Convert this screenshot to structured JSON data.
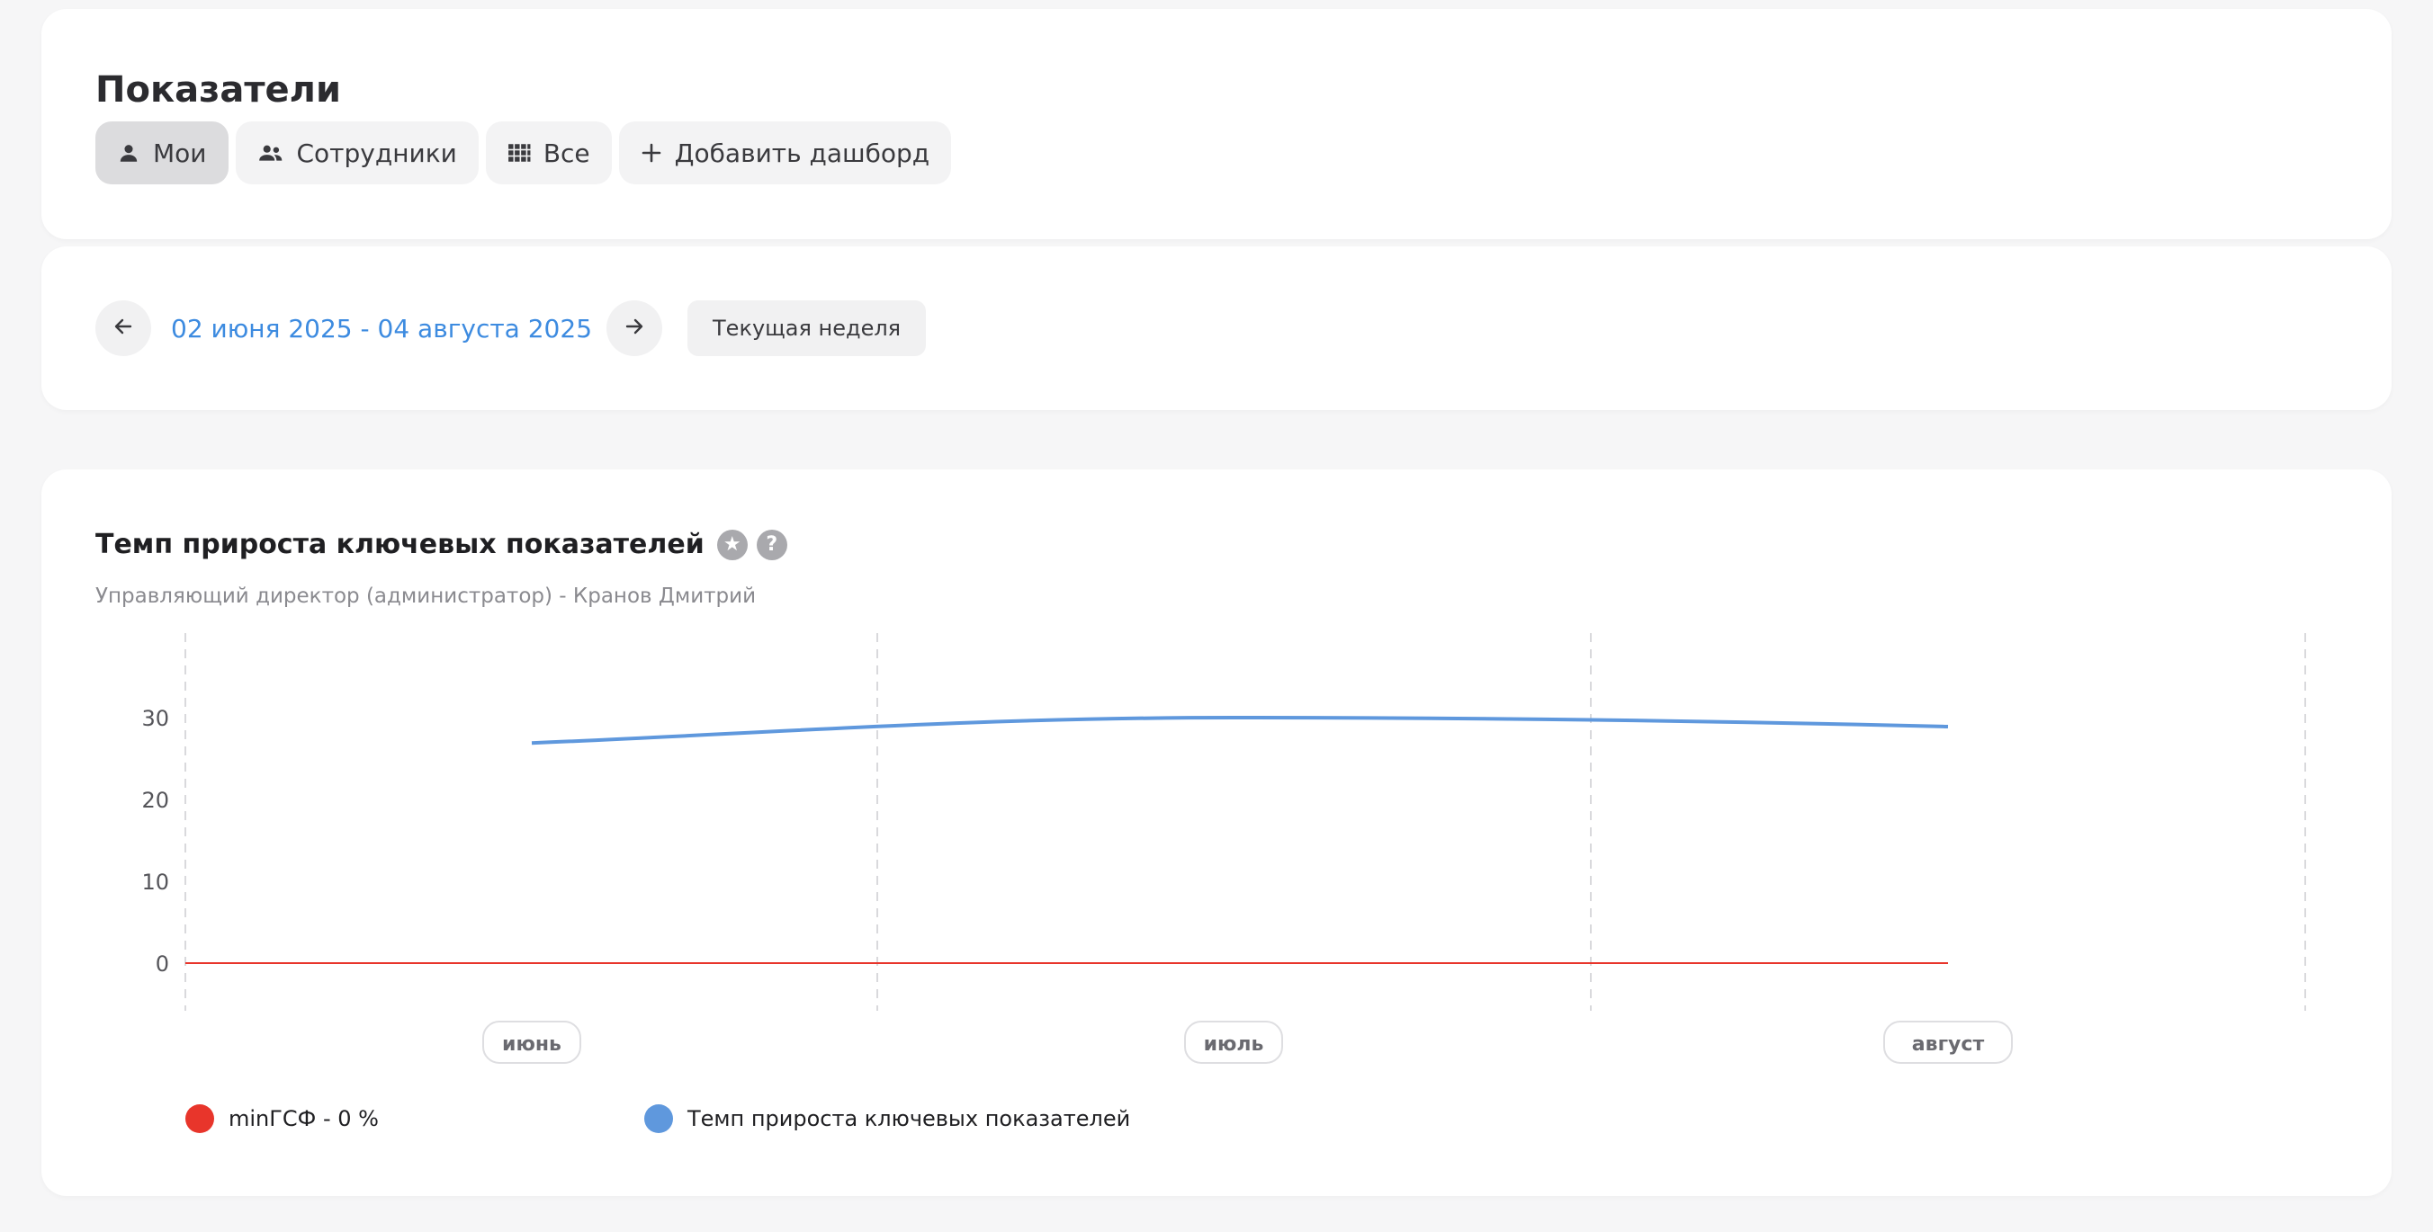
{
  "header": {
    "title": "Показатели",
    "tabs": [
      {
        "label": "Мои",
        "icon": "person-icon"
      },
      {
        "label": "Сотрудники",
        "icon": "people-icon"
      },
      {
        "label": "Все",
        "icon": "grid-icon"
      },
      {
        "label": "Добавить дашборд",
        "icon": "plus-icon"
      }
    ]
  },
  "period": {
    "range": "02 июня 2025 - 04 августа 2025",
    "current_week": "Текущая неделя"
  },
  "chart": {
    "title": "Темп прироста ключевых показателей",
    "subtitle": "Управляющий директор (администратор) - Кранов Дмитрий",
    "legend": [
      {
        "label": "minГСФ - 0 %",
        "color": "#e8352b"
      },
      {
        "label": "Темп прироста ключевых показателей",
        "color": "#5f98dd"
      }
    ]
  },
  "colors": {
    "accent": "#3d8be0",
    "series_red": "#e8352b",
    "series_blue": "#5f98dd"
  },
  "chart_data": {
    "type": "line",
    "categories": [
      "июнь",
      "июль",
      "август"
    ],
    "yticks": [
      0,
      10,
      20,
      30
    ],
    "ylim": [
      -5,
      40
    ],
    "grid": "vertical dashed",
    "legend_position": "bottom-left",
    "series": [
      {
        "name": "minГСФ - 0 %",
        "color": "#e8352b",
        "values": [
          0,
          0,
          0
        ]
      },
      {
        "name": "Темп прироста ключевых показателей",
        "color": "#5f98dd",
        "values": [
          26.9,
          30.0,
          28.9
        ]
      }
    ]
  }
}
